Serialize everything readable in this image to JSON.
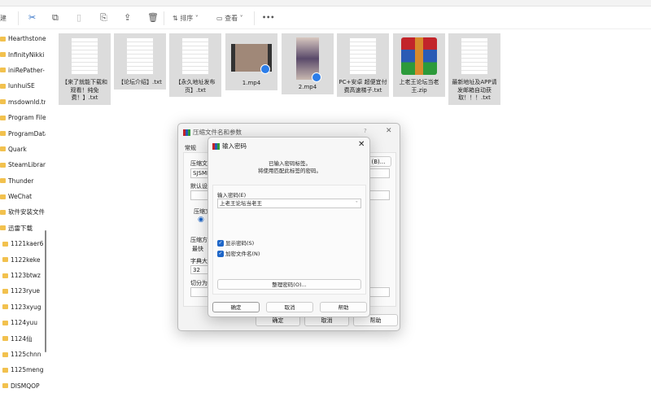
{
  "toolbar": {
    "new_label": "建",
    "sort_label": "排序",
    "view_label": "查看",
    "more_label": "•••"
  },
  "sidebar": {
    "items": [
      "Hearthstone",
      "InfinityNikki",
      "iniRePather-",
      "lunhuiSE",
      "msdownld.tmp",
      "Program Files",
      "ProgramData",
      "Quark",
      "SteamLibrary",
      "Thunder",
      "WeChat",
      "软件安装文件",
      "迅雷下载"
    ],
    "subitems": [
      "1121kaer6",
      "1122keke",
      "1123btwz",
      "1123ryue",
      "1123xyug",
      "1124yuu",
      "1124仙",
      "1125chnn",
      "1125meng",
      "DISMQOP"
    ]
  },
  "files": [
    {
      "name": "【来了就能下载和观看！纯免费！】.txt",
      "type": "txt"
    },
    {
      "name": "【论坛介绍】.txt",
      "type": "txt"
    },
    {
      "name": "【永久地址发布页】.txt",
      "type": "txt"
    },
    {
      "name": "1.mp4",
      "type": "video"
    },
    {
      "name": "2.mp4",
      "type": "video"
    },
    {
      "name": "PC+安卓 超便宜付费高速梯子.txt",
      "type": "txt"
    },
    {
      "name": "上老王论坛当老王.zip",
      "type": "zip"
    },
    {
      "name": "最新地址及APP请发邮箱自动获取！！！.txt",
      "type": "txt"
    }
  ],
  "archive_dialog": {
    "title": "压缩文件名和参数",
    "help": "?",
    "close": "✕",
    "tab_general": "常规",
    "archive_name_label": "压缩文件",
    "archive_name_value": "SJSMD",
    "browse_label": "(B)...",
    "default_label": "默认设置",
    "format_label": "压缩文",
    "compression_label": "压缩方式",
    "compression_value": "最快",
    "dict_label": "字典大小",
    "dict_value": "32",
    "split_label": "切分为分卷",
    "ok": "确定",
    "cancel": "取消",
    "help_btn": "帮助"
  },
  "password_dialog": {
    "title": "输入密码",
    "close": "✕",
    "info_line1": "已输入密码标签。",
    "info_line2": "将使用匹配此标签的密码。",
    "password_label": "输入密码(E)",
    "password_value": "上老王论坛当老王",
    "show_password": "显示密码(S)",
    "encrypt_names": "加密文件名(N)",
    "organize": "整理密码(O)...",
    "ok": "确定",
    "cancel": "取消",
    "help": "帮助"
  }
}
